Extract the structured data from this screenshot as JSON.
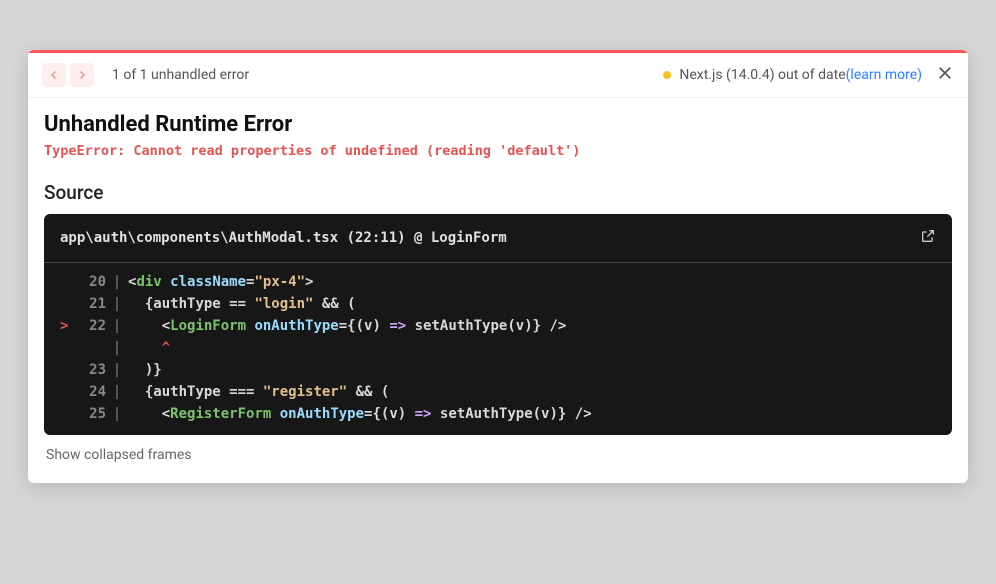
{
  "header": {
    "counter": "1 of 1 unhandled error",
    "version_label": "Next.js (14.0.4) out of date ",
    "learn_more": "(learn more)"
  },
  "error": {
    "title": "Unhandled Runtime Error",
    "message": "TypeError: Cannot read properties of undefined (reading 'default')"
  },
  "source": {
    "label": "Source",
    "file_location": "app\\auth\\components\\AuthModal.tsx (22:11) @ LoginForm",
    "lines": [
      {
        "n": "20",
        "mark": "",
        "seg": [
          {
            "c": "t-punc",
            "t": "<"
          },
          {
            "c": "t-tag",
            "t": "div"
          },
          {
            "c": "t-punc",
            "t": " "
          },
          {
            "c": "t-attr",
            "t": "className"
          },
          {
            "c": "t-punc",
            "t": "="
          },
          {
            "c": "t-str",
            "t": "\"px-4\""
          },
          {
            "c": "t-punc",
            "t": ">"
          }
        ]
      },
      {
        "n": "21",
        "mark": "",
        "indent": "  ",
        "seg": [
          {
            "c": "t-punc",
            "t": "{"
          },
          {
            "c": "t-ident",
            "t": "authType "
          },
          {
            "c": "t-op",
            "t": "== "
          },
          {
            "c": "t-str",
            "t": "\"login\""
          },
          {
            "c": "t-punc",
            "t": " && ("
          }
        ]
      },
      {
        "n": "22",
        "mark": ">",
        "indent": "    ",
        "seg": [
          {
            "c": "t-punc",
            "t": "<"
          },
          {
            "c": "t-tag",
            "t": "LoginForm"
          },
          {
            "c": "t-punc",
            "t": " "
          },
          {
            "c": "t-attr",
            "t": "onAuthType"
          },
          {
            "c": "t-punc",
            "t": "={"
          },
          {
            "c": "t-ident",
            "t": "(v) "
          },
          {
            "c": "t-key",
            "t": "=>"
          },
          {
            "c": "t-ident",
            "t": " setAuthType(v)"
          },
          {
            "c": "t-punc",
            "t": "} />"
          }
        ]
      },
      {
        "n": "",
        "mark": "",
        "indent": "    ",
        "seg": [
          {
            "c": "t-caret",
            "t": "^"
          }
        ]
      },
      {
        "n": "23",
        "mark": "",
        "indent": "  ",
        "seg": [
          {
            "c": "t-punc",
            "t": ")}"
          }
        ]
      },
      {
        "n": "24",
        "mark": "",
        "indent": "  ",
        "seg": [
          {
            "c": "t-punc",
            "t": "{"
          },
          {
            "c": "t-ident",
            "t": "authType "
          },
          {
            "c": "t-op",
            "t": "=== "
          },
          {
            "c": "t-str",
            "t": "\"register\""
          },
          {
            "c": "t-punc",
            "t": " && ("
          }
        ]
      },
      {
        "n": "25",
        "mark": "",
        "indent": "    ",
        "seg": [
          {
            "c": "t-punc",
            "t": "<"
          },
          {
            "c": "t-tag",
            "t": "RegisterForm"
          },
          {
            "c": "t-punc",
            "t": " "
          },
          {
            "c": "t-attr",
            "t": "onAuthType"
          },
          {
            "c": "t-punc",
            "t": "={"
          },
          {
            "c": "t-ident",
            "t": "(v) "
          },
          {
            "c": "t-key",
            "t": "=>"
          },
          {
            "c": "t-ident",
            "t": " setAuthType(v)"
          },
          {
            "c": "t-punc",
            "t": "} />"
          }
        ]
      }
    ],
    "show_collapsed": "Show collapsed frames"
  }
}
